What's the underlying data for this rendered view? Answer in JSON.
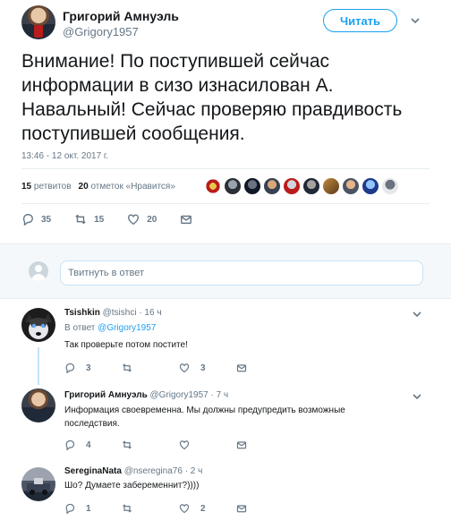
{
  "tweet": {
    "author_name": "Григорий Амнуэль",
    "author_handle": "@Grigory1957",
    "follow_label": "Читать",
    "text": "Внимание! По поступившей сейчас информации в сизо  изнасилован А. Навальный! Сейчас проверяю правдивость поступившей сообщения.",
    "timestamp": "13:46 - 12 окт. 2017 г.",
    "retweets_count": "15",
    "retweets_label": "ретвитов",
    "likes_count": "20",
    "likes_label": "отметок «Нравится»",
    "reply_count": "35",
    "retweet_action_count": "15",
    "like_action_count": "20"
  },
  "composer": {
    "placeholder": "Твитнуть в ответ"
  },
  "replies": [
    {
      "name": "Tsishkin",
      "handle": "@tsishci",
      "time": "· 16 ч",
      "reply_to_prefix": "В ответ",
      "reply_to_handle": "@Grigory1957",
      "text": "Так проверьте потом постите!",
      "reply_count": "3",
      "retweet_count": "",
      "like_count": "3"
    },
    {
      "name": "Григорий Амнуэль",
      "handle": "@Grigory1957",
      "time": "· 7 ч",
      "text": "Информация своевременна. Мы должны предупредить  возможные последствия.",
      "reply_count": "4",
      "retweet_count": "",
      "like_count": ""
    },
    {
      "name": "SereginaNata",
      "handle": "@nseregina76",
      "time": "· 2 ч",
      "text": "Шо? Думаете забеременнит?))))",
      "reply_count": "1",
      "retweet_count": "",
      "like_count": "2"
    }
  ],
  "colors": {
    "accent": "#1da1f2",
    "muted": "#657786",
    "text": "#14171a",
    "thread": "#c4e3f7"
  },
  "icons": [
    "caret-down-icon",
    "reply-icon",
    "retweet-icon",
    "heart-icon",
    "envelope-icon"
  ]
}
